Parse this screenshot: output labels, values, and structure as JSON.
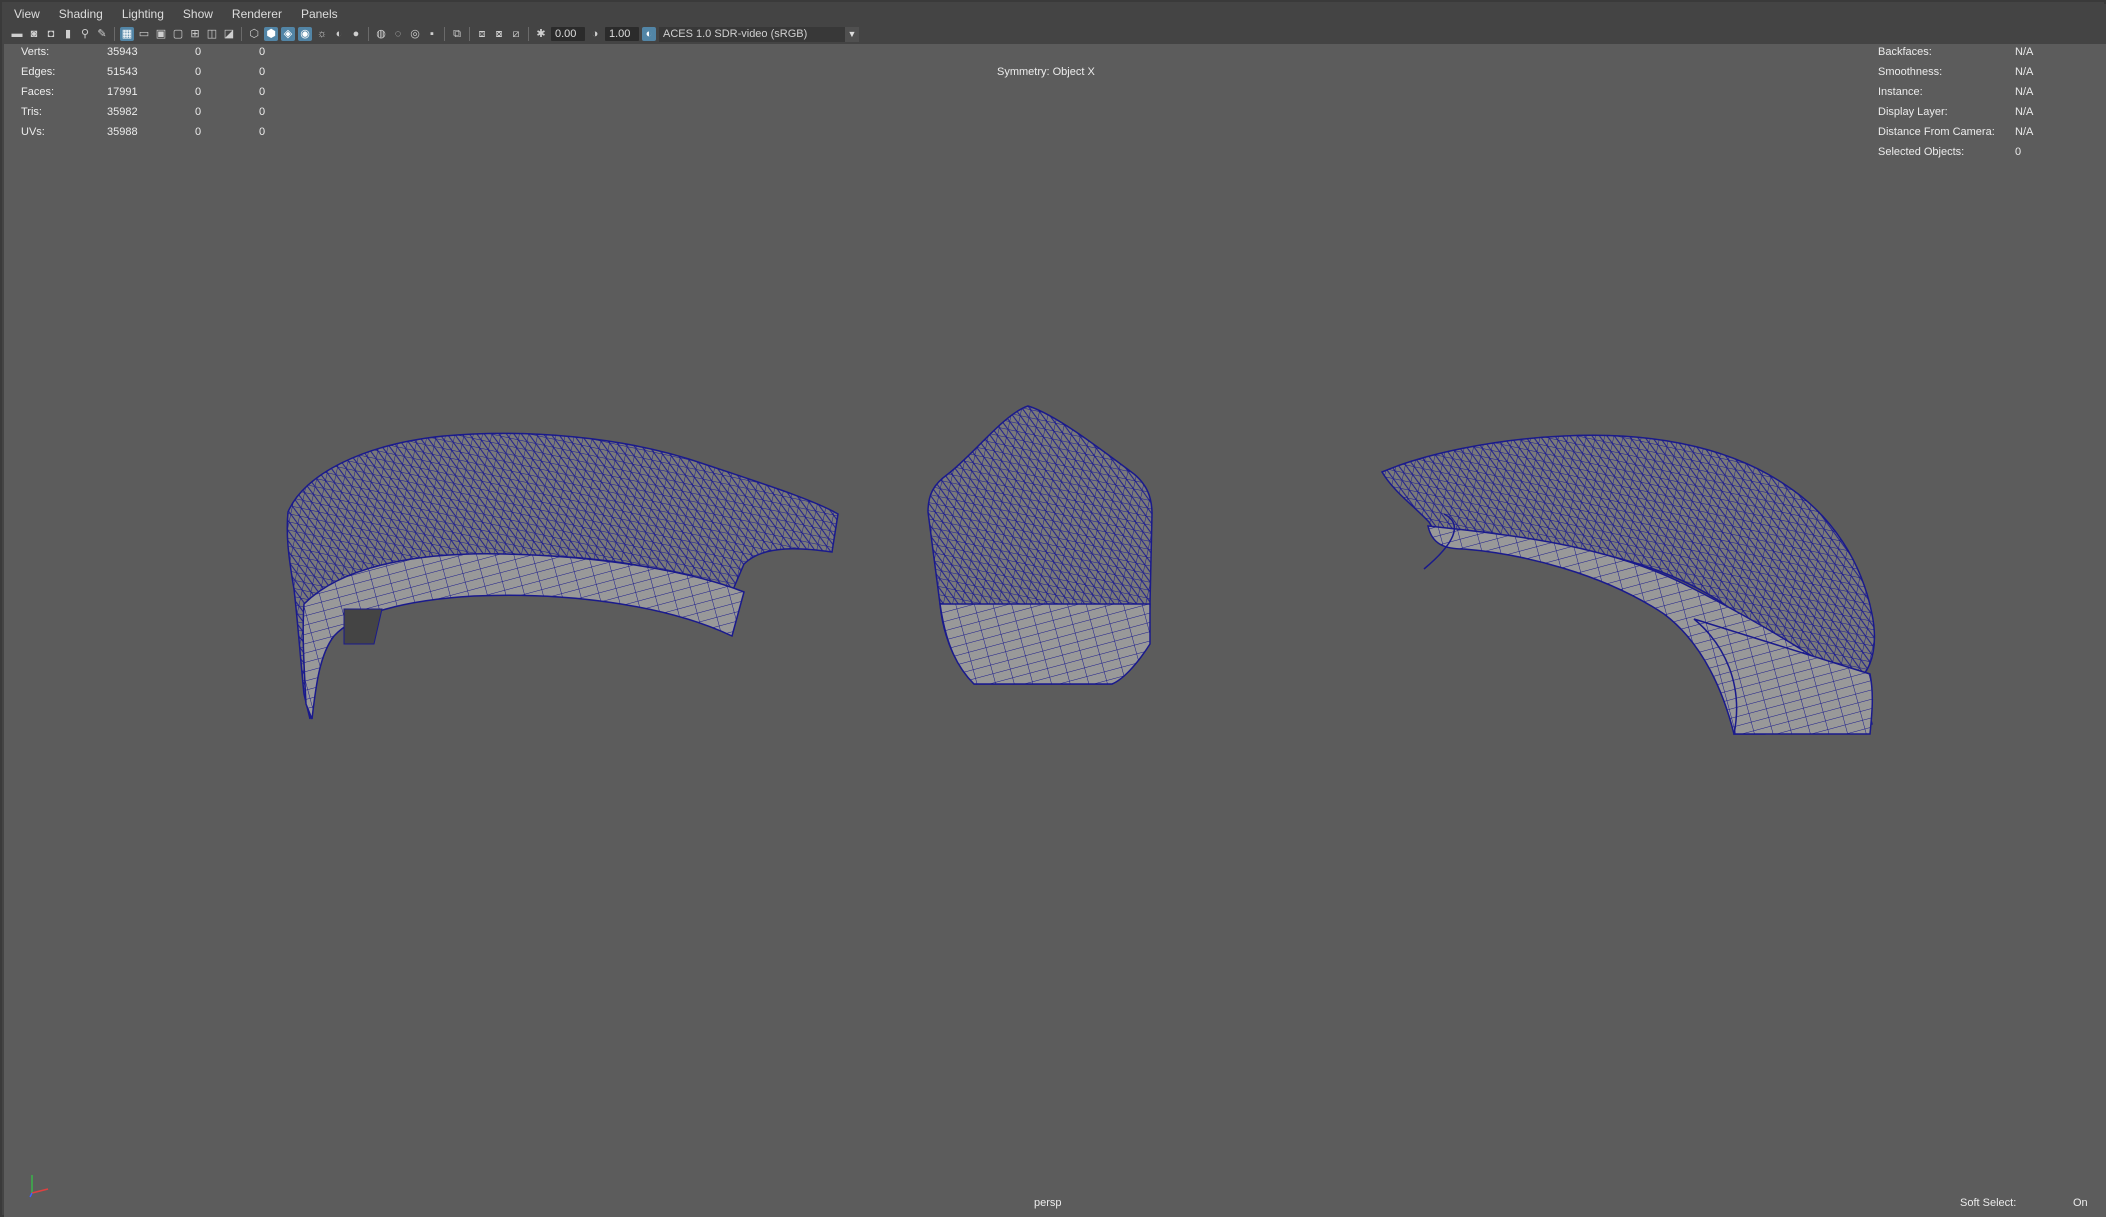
{
  "menu": [
    "View",
    "Shading",
    "Lighting",
    "Show",
    "Renderer",
    "Panels"
  ],
  "toolbar": {
    "exposure": "0.00",
    "gamma": "1.00",
    "color_space": "ACES 1.0 SDR-video (sRGB)"
  },
  "hud_left": [
    {
      "label": "Verts:",
      "total": "35943",
      "selected": "0",
      "highlight": "0"
    },
    {
      "label": "Edges:",
      "total": "51543",
      "selected": "0",
      "highlight": "0"
    },
    {
      "label": "Faces:",
      "total": "17991",
      "selected": "0",
      "highlight": "0"
    },
    {
      "label": "Tris:",
      "total": "35982",
      "selected": "0",
      "highlight": "0"
    },
    {
      "label": "UVs:",
      "total": "35988",
      "selected": "0",
      "highlight": "0"
    }
  ],
  "hud_right": [
    {
      "label": "Backfaces:",
      "value": "N/A"
    },
    {
      "label": "Smoothness:",
      "value": "N/A"
    },
    {
      "label": "Instance:",
      "value": "N/A"
    },
    {
      "label": "Display Layer:",
      "value": "N/A"
    },
    {
      "label": "Distance From Camera:",
      "value": "N/A"
    },
    {
      "label": "Selected Objects:",
      "value": "0"
    }
  ],
  "symmetry": "Symmetry: Object X",
  "camera": "persp",
  "soft_select": {
    "label": "Soft Select:",
    "value": "On"
  },
  "colors": {
    "wireframe": "#1a1a8c",
    "mesh_fill": "#8c8c8c",
    "viewport_bg": "#5c5c5c"
  }
}
